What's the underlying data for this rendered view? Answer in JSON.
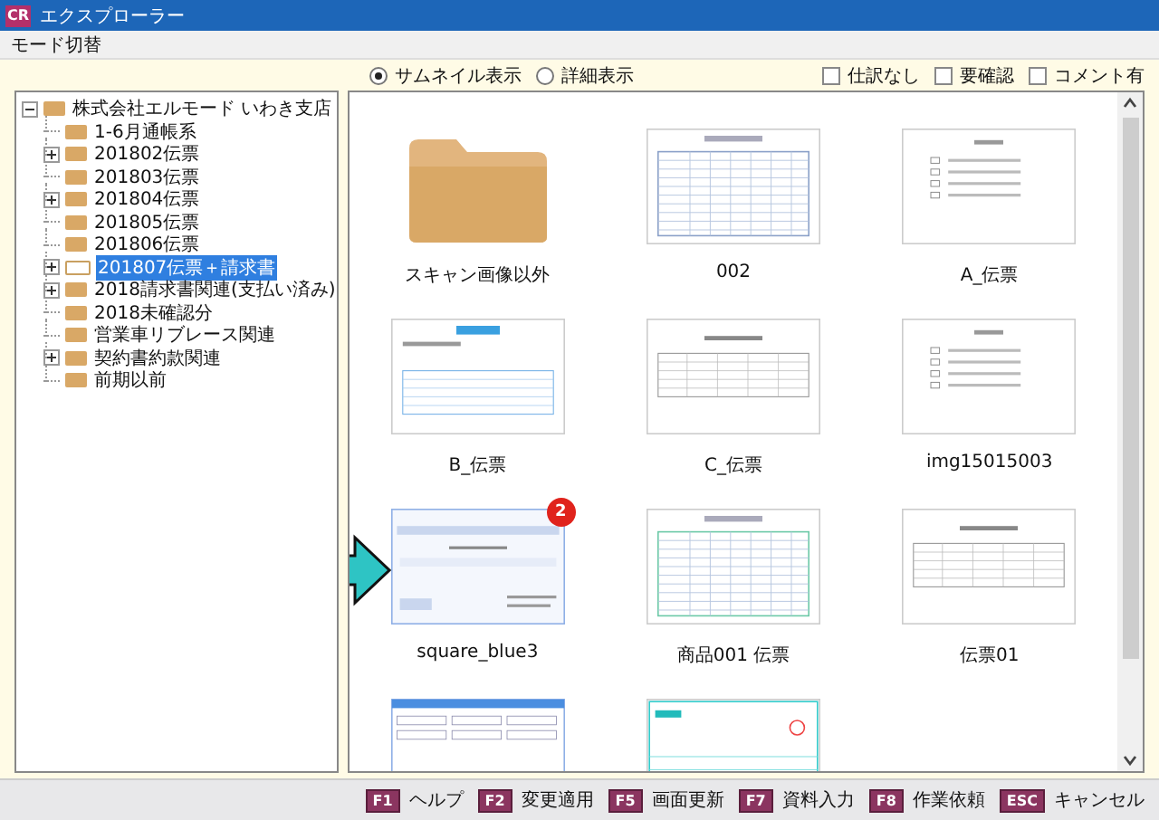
{
  "window": {
    "app_badge": "CR",
    "title": "エクスプローラー"
  },
  "menu": [
    "モード切替"
  ],
  "view_modes": [
    {
      "label": "サムネイル表示",
      "selected": true
    },
    {
      "label": "詳細表示",
      "selected": false
    }
  ],
  "filters": [
    {
      "label": "仕訳なし",
      "checked": false
    },
    {
      "label": "要確認",
      "checked": false
    },
    {
      "label": "コメント有",
      "checked": false
    }
  ],
  "tree": {
    "label": "株式会社エルモード いわき支店",
    "expanded": true,
    "selected": false,
    "children": [
      {
        "label": "1-6月通帳系",
        "kind": "leaf",
        "selected": false
      },
      {
        "label": "201802伝票",
        "kind": "collapsed",
        "selected": false
      },
      {
        "label": "201803伝票",
        "kind": "leaf",
        "selected": false
      },
      {
        "label": "201804伝票",
        "kind": "collapsed",
        "selected": false
      },
      {
        "label": "201805伝票",
        "kind": "leaf",
        "selected": false
      },
      {
        "label": "201806伝票",
        "kind": "leaf",
        "selected": false
      },
      {
        "label": "201807伝票＋請求書",
        "kind": "collapsed",
        "selected": true
      },
      {
        "label": "2018請求書関連(支払い済み)",
        "kind": "collapsed",
        "selected": false
      },
      {
        "label": "2018未確認分",
        "kind": "leaf",
        "selected": false
      },
      {
        "label": "営業車リブレース関連",
        "kind": "leaf",
        "selected": false
      },
      {
        "label": "契約書約款関連",
        "kind": "collapsed",
        "selected": false
      },
      {
        "label": "前期以前",
        "kind": "leaf",
        "selected": false
      }
    ]
  },
  "thumbnails": [
    {
      "label": "スキャン画像以外",
      "kind": "folder",
      "pointer": false
    },
    {
      "label": "002",
      "kind": "form",
      "pointer": false
    },
    {
      "label": "A_伝票",
      "kind": "sparse",
      "pointer": false
    },
    {
      "label": "B_伝票",
      "kind": "invoice",
      "pointer": false
    },
    {
      "label": "C_伝票",
      "kind": "table",
      "pointer": false
    },
    {
      "label": "img15015003",
      "kind": "sparse",
      "pointer": false
    },
    {
      "label": "square_blue3",
      "kind": "receipt",
      "badge": "2",
      "pointer": true
    },
    {
      "label": "商品001 伝票",
      "kind": "ledger",
      "pointer": false
    },
    {
      "label": "伝票01",
      "kind": "table",
      "pointer": false
    },
    {
      "kind": "screen",
      "pointer": false
    },
    {
      "kind": "slip",
      "pointer": false
    }
  ],
  "function_keys": [
    {
      "key": "F1",
      "label": "ヘルプ"
    },
    {
      "key": "F2",
      "label": "変更適用"
    },
    {
      "key": "F5",
      "label": "画面更新"
    },
    {
      "key": "F7",
      "label": "資料入力"
    },
    {
      "key": "F8",
      "label": "作業依頼"
    },
    {
      "key": "ESC",
      "label": "キャンセル"
    }
  ]
}
